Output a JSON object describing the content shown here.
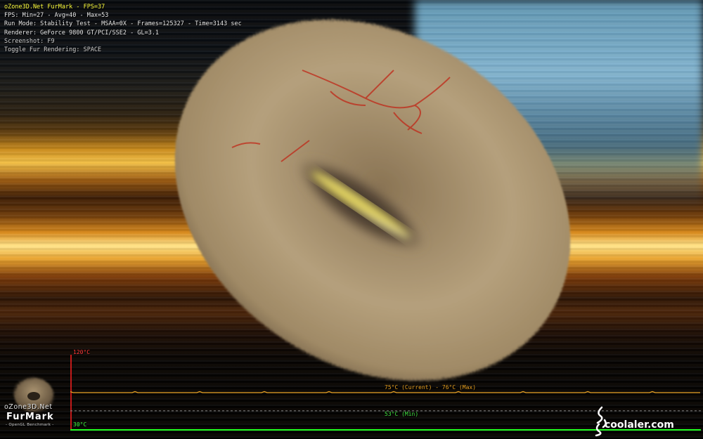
{
  "hud": {
    "title": "oZone3D.Net FurMark - FPS=37",
    "fps_line": "FPS: Min=27 - Avg=40 - Max=53",
    "run_mode": "Run Mode: Stability Test - MSAA=0X - Frames=125327 - Time=3143 sec",
    "renderer": "Renderer: GeForce 9800 GT/PCI/SSE2 - GL=3.1",
    "screenshot": "Screenshot: F9",
    "toggle": "Toggle Fur Rendering: SPACE"
  },
  "temp_graph": {
    "max_label": "120°C",
    "min_label": "30°C",
    "current_label": "75°C (Current) - 76°C (Max)",
    "min_value_label": "53°C (Min)",
    "scale_max_c": 120,
    "scale_min_c": 30,
    "current_c": 75,
    "max_c": 76,
    "min_c": 53,
    "colors": {
      "axis": "#ff2020",
      "baseline": "#20ff20",
      "current": "#e8a020",
      "min": "#40e040"
    }
  },
  "logo": {
    "brand": "oZone3D.Net",
    "name": "FurMark",
    "subtitle": "- OpenGL Benchmark -"
  },
  "watermark": {
    "text": "coolaler.com",
    "icon": "calligraphy-signature-icon"
  },
  "scene": {
    "object": "fur-torus",
    "colors": {
      "fur": "#b8a078",
      "vein": "#c02818",
      "glow": "#ffe34a"
    }
  }
}
